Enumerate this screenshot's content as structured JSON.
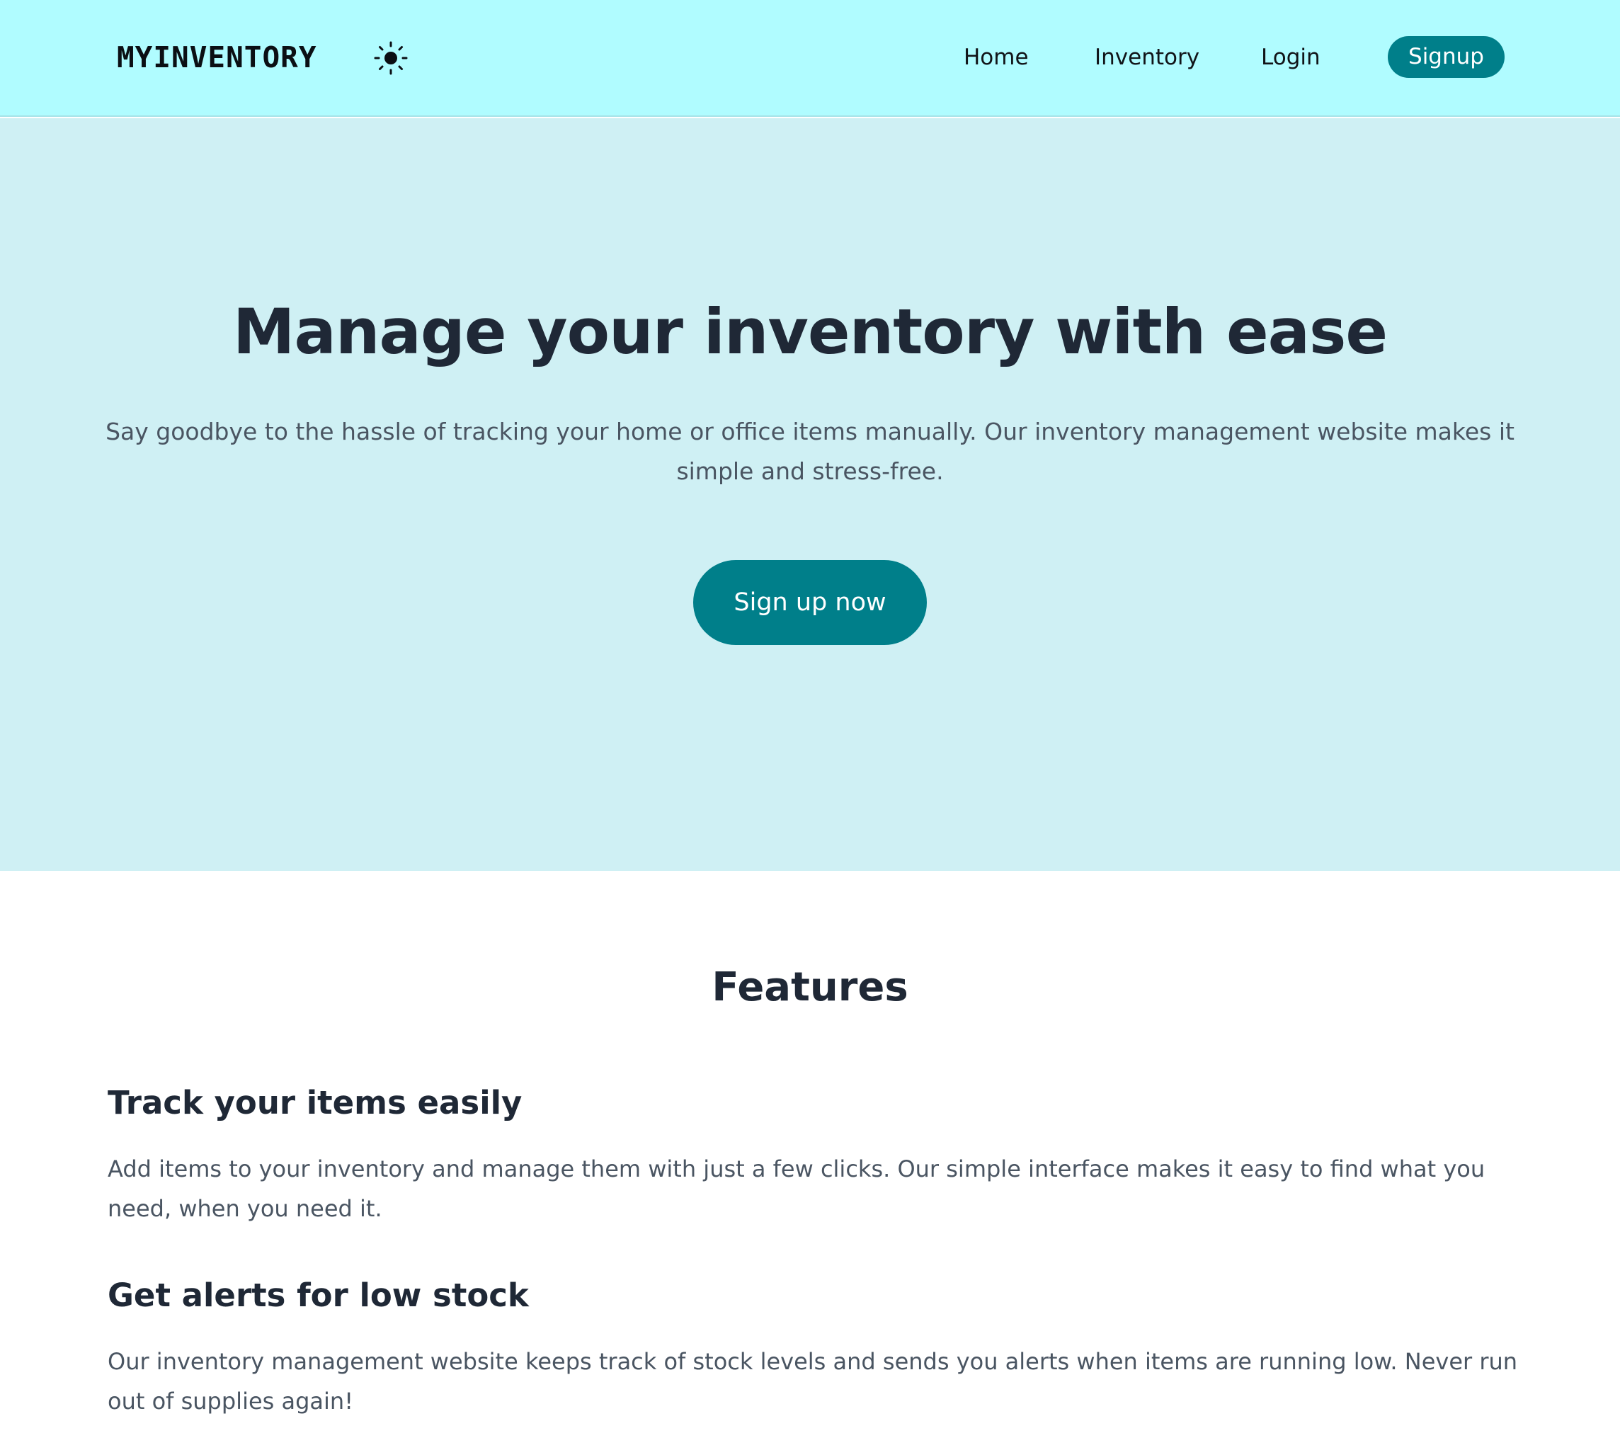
{
  "nav": {
    "brand": "MYINVENTORY",
    "theme_icon": "sun-icon",
    "links": [
      {
        "label": "Home"
      },
      {
        "label": "Inventory"
      },
      {
        "label": "Login"
      }
    ],
    "signup_label": "Signup"
  },
  "hero": {
    "title": "Manage your inventory with ease",
    "subtitle": "Say goodbye to the hassle of tracking your home or office items manually. Our inventory management website makes it simple and stress-free.",
    "cta_label": "Sign up now"
  },
  "features": {
    "title": "Features",
    "items": [
      {
        "heading": "Track your items easily",
        "text": "Add items to your inventory and manage them with just a few clicks. Our simple interface makes it easy to find what you need, when you need it."
      },
      {
        "heading": "Get alerts for low stock",
        "text": "Our inventory management website keeps track of stock levels and sends you alerts when items are running low. Never run out of supplies again!"
      }
    ]
  },
  "colors": {
    "nav_bg": "#b0fcff",
    "hero_bg": "#cff0f4",
    "accent": "#007f8a",
    "heading": "#1f2836",
    "body_text": "#4a5562"
  }
}
